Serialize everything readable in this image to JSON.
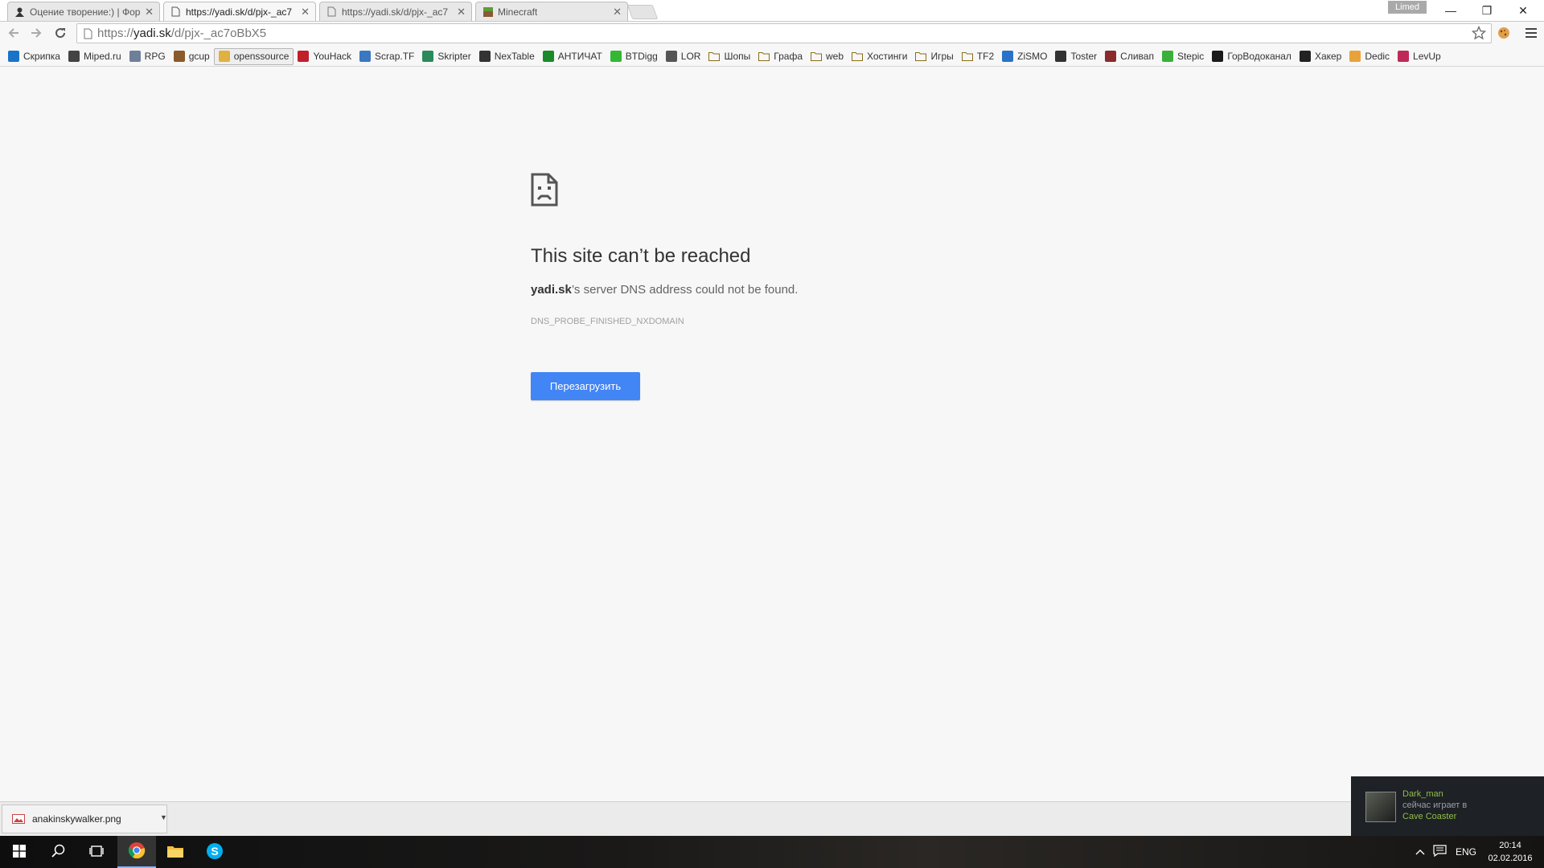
{
  "tabs": [
    {
      "label": "Оцение творение:) | Фор",
      "icon": "user-avatar-icon",
      "active": false
    },
    {
      "label": "https://yadi.sk/d/pjx-_ac7",
      "icon": "page-icon",
      "active": true
    },
    {
      "label": "https://yadi.sk/d/pjx-_ac7",
      "icon": "page-icon",
      "active": false
    },
    {
      "label": "Minecraft",
      "icon": "minecraft-block-icon",
      "active": false
    }
  ],
  "tab_close_glyph": "✕",
  "profile": {
    "label": "Limed"
  },
  "window_controls": {
    "minimize": "—",
    "maximize": "❐",
    "close": "✕"
  },
  "address_bar": {
    "prefix": "https://",
    "host": "yadi.sk",
    "path": "/d/pjx-_ac7oBbX5"
  },
  "bookmarks": [
    {
      "label": "Скрипка",
      "icon": "skripka-icon",
      "color": "#1a73c8"
    },
    {
      "label": "Miped.ru",
      "icon": "miped-icon",
      "color": "#444444"
    },
    {
      "label": "RPG",
      "icon": "rpg-icon",
      "color": "#6f7f9a"
    },
    {
      "label": "gcup",
      "icon": "gcup-icon",
      "color": "#8a5a2b"
    },
    {
      "label": "openssource",
      "icon": "openssource-icon",
      "color": "#e0b040",
      "highlighted": true
    },
    {
      "label": "YouHack",
      "icon": "youhack-icon",
      "color": "#c0202a"
    },
    {
      "label": "Scrap.TF",
      "icon": "scraptf-icon",
      "color": "#3a78c0"
    },
    {
      "label": "Skripter",
      "icon": "skripter-icon",
      "color": "#2a8a5a"
    },
    {
      "label": "NexTable",
      "icon": "nextable-icon",
      "color": "#333333"
    },
    {
      "label": "АНТИЧАТ",
      "icon": "antichat-icon",
      "color": "#1a8a2a"
    },
    {
      "label": "BTDigg",
      "icon": "btdigg-icon",
      "color": "#32b832"
    },
    {
      "label": "LOR",
      "icon": "lor-icon",
      "color": "#555555"
    },
    {
      "label": "Шопы",
      "icon": "folder-icon",
      "color": "#e9c46a"
    },
    {
      "label": "Графа",
      "icon": "folder-icon",
      "color": "#e9c46a"
    },
    {
      "label": "web",
      "icon": "folder-icon",
      "color": "#e9c46a"
    },
    {
      "label": "Хостинги",
      "icon": "folder-icon",
      "color": "#e9c46a"
    },
    {
      "label": "Игры",
      "icon": "folder-icon",
      "color": "#e9c46a"
    },
    {
      "label": "TF2",
      "icon": "folder-icon",
      "color": "#e9c46a"
    },
    {
      "label": "ZiSMO",
      "icon": "zismo-icon",
      "color": "#2a72c8"
    },
    {
      "label": "Toster",
      "icon": "toster-icon",
      "color": "#333333"
    },
    {
      "label": "Сливап",
      "icon": "slivap-icon",
      "color": "#8a2a2a"
    },
    {
      "label": "Stepic",
      "icon": "stepic-icon",
      "color": "#3ab03a"
    },
    {
      "label": "ГорВодоканал",
      "icon": "gorvodokanal-icon",
      "color": "#1a1a1a"
    },
    {
      "label": "Хакер",
      "icon": "xakep-icon",
      "color": "#222222"
    },
    {
      "label": "Dedic",
      "icon": "dedic-icon",
      "color": "#e9a23a"
    },
    {
      "label": "LevUp",
      "icon": "levup-icon",
      "color": "#c02a5a"
    }
  ],
  "error": {
    "title": "This site can’t be reached",
    "host": "yadi.sk",
    "description": "’s server DNS address could not be found.",
    "code": "DNS_PROBE_FINISHED_NXDOMAIN",
    "reload_button": "Перезагрузить"
  },
  "download": {
    "filename": "anakinskywalker.png",
    "icon": "image-file-icon"
  },
  "notification": {
    "user": "Dark_man",
    "status": "сейчас играет в",
    "game": "Cave Coaster"
  },
  "tray": {
    "language": "ENG",
    "time": "20:14",
    "date": "02.02.2016"
  },
  "colors": {
    "accent": "#4285f4",
    "steam_green": "#8fbf48"
  }
}
